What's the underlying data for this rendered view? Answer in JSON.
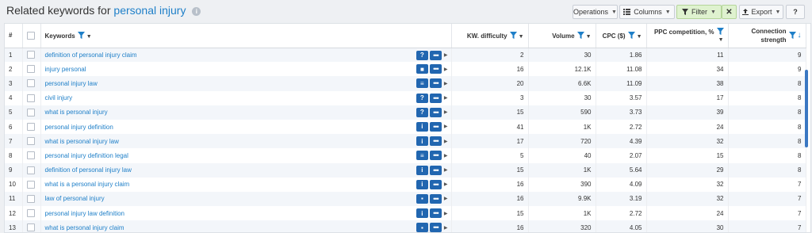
{
  "header": {
    "title_prefix": "Related keywords for",
    "keyword": "personal injury",
    "info_glyph": "i"
  },
  "toolbar": {
    "operations": "Operations",
    "columns": "Columns",
    "filter": "Filter",
    "close": "✕",
    "export": "Export",
    "help": "?"
  },
  "columns": {
    "index": "#",
    "keywords": "Keywords",
    "kw_difficulty": "KW. difficulty",
    "volume": "Volume",
    "cpc": "CPC ($)",
    "ppc": "PPC competition, %",
    "connection_line1": "Connection",
    "connection_line2": "strength"
  },
  "rows": [
    {
      "n": "1",
      "keyword": "definition of personal injury claim",
      "intent_icon": "question-icon",
      "glyph": "?",
      "kd": "2",
      "volume": "30",
      "cpc": "1.86",
      "ppc": "11",
      "strength": "9"
    },
    {
      "n": "2",
      "keyword": "injury personal",
      "intent_icon": "video-icon",
      "glyph": "■",
      "kd": "16",
      "volume": "12.1K",
      "cpc": "11.08",
      "ppc": "34",
      "strength": "9"
    },
    {
      "n": "3",
      "keyword": "personal injury law",
      "intent_icon": "list-icon",
      "glyph": "≡",
      "kd": "20",
      "volume": "6.6K",
      "cpc": "11.09",
      "ppc": "38",
      "strength": "8"
    },
    {
      "n": "4",
      "keyword": "civil injury",
      "intent_icon": "question-icon",
      "glyph": "?",
      "kd": "3",
      "volume": "30",
      "cpc": "3.57",
      "ppc": "17",
      "strength": "8"
    },
    {
      "n": "5",
      "keyword": "what is personal injury",
      "intent_icon": "question-icon",
      "glyph": "?",
      "kd": "15",
      "volume": "590",
      "cpc": "3.73",
      "ppc": "39",
      "strength": "8"
    },
    {
      "n": "6",
      "keyword": "personal injury definition",
      "intent_icon": "info-icon",
      "glyph": "i",
      "kd": "41",
      "volume": "1K",
      "cpc": "2.72",
      "ppc": "24",
      "strength": "8"
    },
    {
      "n": "7",
      "keyword": "what is personal injury law",
      "intent_icon": "info-icon",
      "glyph": "i",
      "kd": "17",
      "volume": "720",
      "cpc": "4.39",
      "ppc": "32",
      "strength": "8"
    },
    {
      "n": "8",
      "keyword": "personal injury definition legal",
      "intent_icon": "text-icon",
      "glyph": "≡",
      "kd": "5",
      "volume": "40",
      "cpc": "2.07",
      "ppc": "15",
      "strength": "8"
    },
    {
      "n": "9",
      "keyword": "definition of personal injury law",
      "intent_icon": "info-icon",
      "glyph": "i",
      "kd": "15",
      "volume": "1K",
      "cpc": "5.64",
      "ppc": "29",
      "strength": "8"
    },
    {
      "n": "10",
      "keyword": "what is a personal injury claim",
      "intent_icon": "info-icon",
      "glyph": "i",
      "kd": "16",
      "volume": "390",
      "cpc": "4.09",
      "ppc": "32",
      "strength": "7"
    },
    {
      "n": "11",
      "keyword": "law of personal injury",
      "intent_icon": "comment-icon",
      "glyph": "▪",
      "kd": "16",
      "volume": "9.9K",
      "cpc": "3.19",
      "ppc": "32",
      "strength": "7"
    },
    {
      "n": "12",
      "keyword": "personal injury law definition",
      "intent_icon": "info-icon",
      "glyph": "i",
      "kd": "15",
      "volume": "1K",
      "cpc": "2.72",
      "ppc": "24",
      "strength": "7"
    },
    {
      "n": "13",
      "keyword": "what is personal injury claim",
      "intent_icon": "comment-icon",
      "glyph": "▪",
      "kd": "16",
      "volume": "320",
      "cpc": "4.05",
      "ppc": "30",
      "strength": "7"
    }
  ],
  "colors": {
    "accent": "#1e7fc8",
    "action_button": "#2166b0",
    "filter_bg": "#dff2cf"
  }
}
